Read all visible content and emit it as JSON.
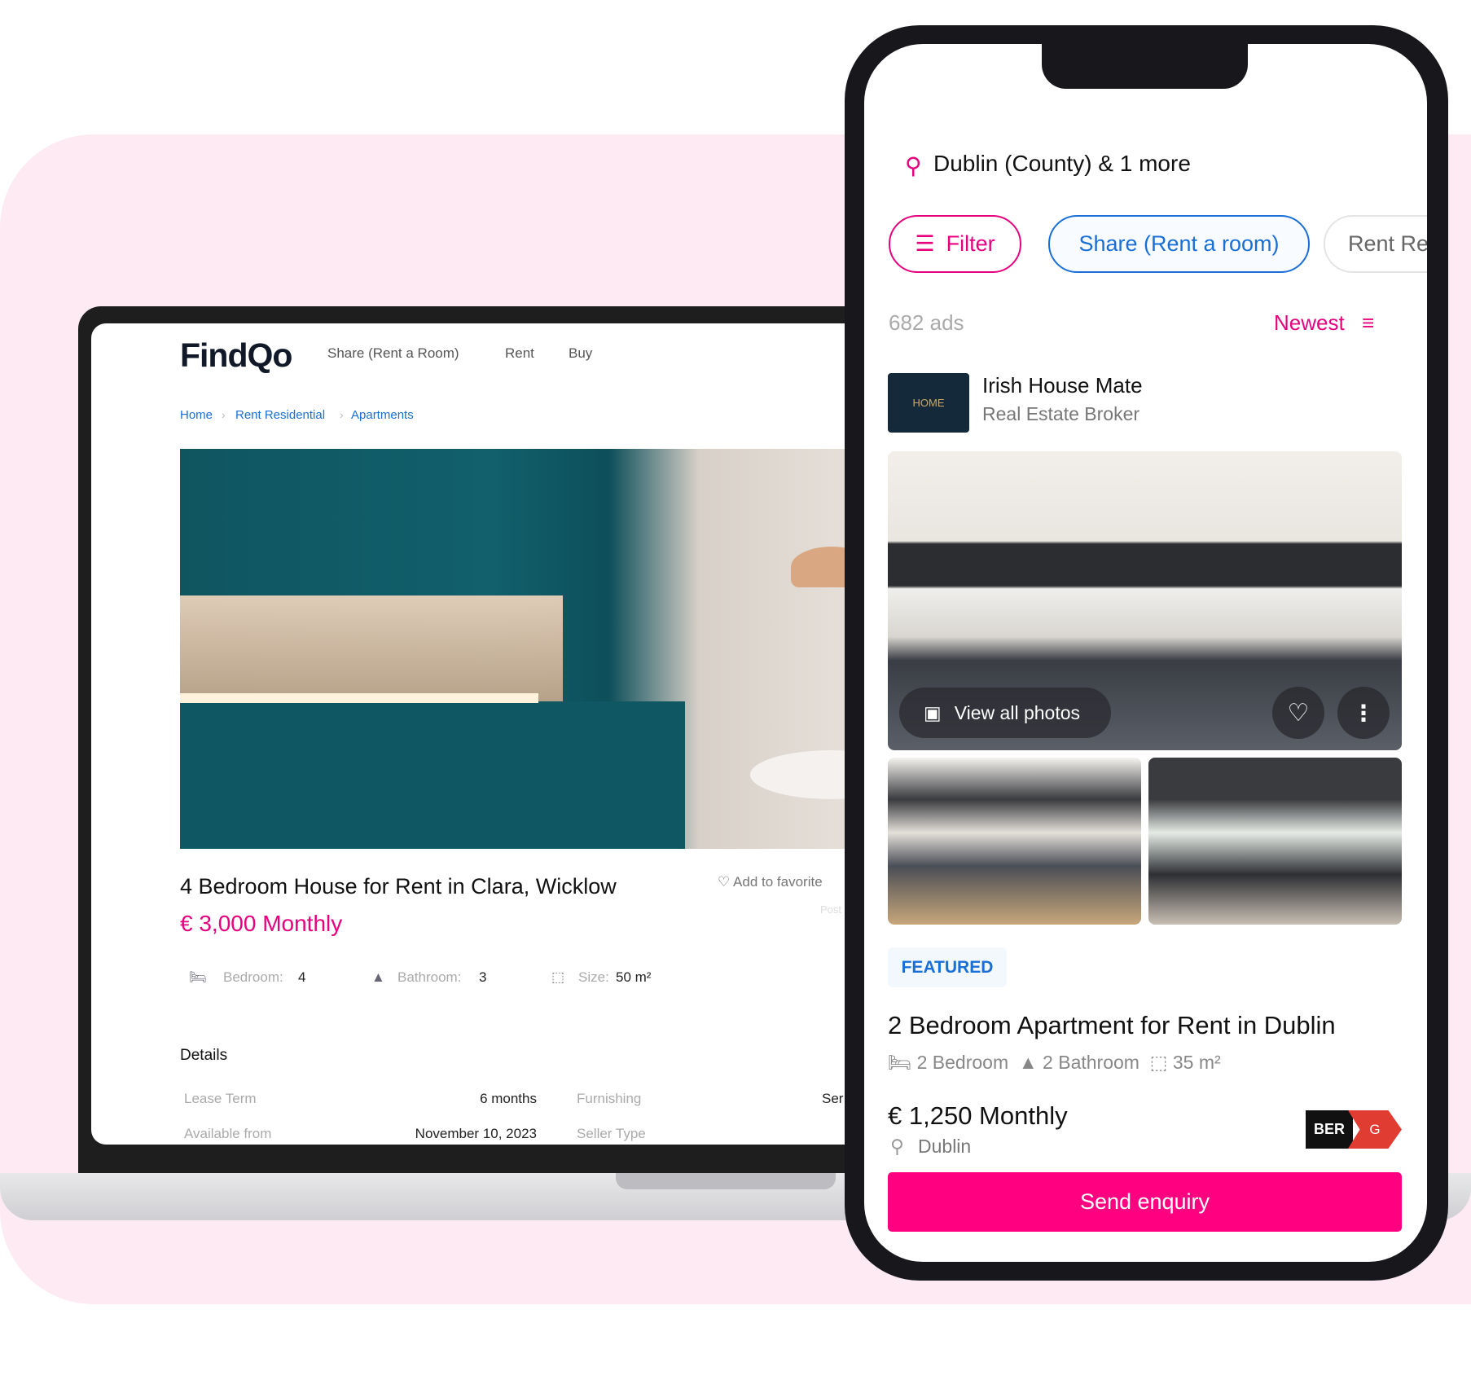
{
  "colors": {
    "brand_pink": "#e6007e",
    "link_blue": "#1a6fd6",
    "background_pink": "#fdeaf3",
    "ber_red": "#e03c31"
  },
  "laptop": {
    "logo": "FindQo",
    "nav": [
      "Share (Rent a Room)",
      "Rent",
      "Buy"
    ],
    "breadcrumb": [
      "Home",
      "Rent Residential",
      "Apartments"
    ],
    "listing": {
      "title": "4 Bedroom House for Rent in Clara, Wicklow",
      "price": "€ 3,000 Monthly",
      "favorite_label": "Add to favorite",
      "posted_label": "Post",
      "features": {
        "bedroom_label": "Bedroom:",
        "bedroom_value": "4",
        "bathroom_label": "Bathroom:",
        "bathroom_value": "3",
        "size_label": "Size:",
        "size_value": "50 m²"
      }
    },
    "details": {
      "heading": "Details",
      "rows": [
        {
          "label": "Lease Term",
          "value": "6 months",
          "label2": "Furnishing",
          "value2": "Ser"
        },
        {
          "label": "Available from",
          "value": "November 10, 2023",
          "label2": "Seller Type",
          "value2": ""
        }
      ]
    }
  },
  "phone": {
    "location": "Dublin (County) & 1 more",
    "chips": [
      "Filter",
      "Share (Rent a room)",
      "Rent Re"
    ],
    "ads_count": "682 ads",
    "sort": "Newest",
    "broker": {
      "logo_text": "HOME",
      "name": "Irish House Mate",
      "type": "Real Estate Broker"
    },
    "view_photos": "View all photos",
    "badge": "FEATURED",
    "title": "2 Bedroom Apartment for Rent in Dublin",
    "features": [
      "2 Bedroom",
      "2 Bathroom",
      "35 m²"
    ],
    "price": "€ 1,250 Monthly",
    "place": "Dublin",
    "ber": {
      "label": "BER",
      "rating": "G"
    },
    "cta": "Send enquiry"
  }
}
